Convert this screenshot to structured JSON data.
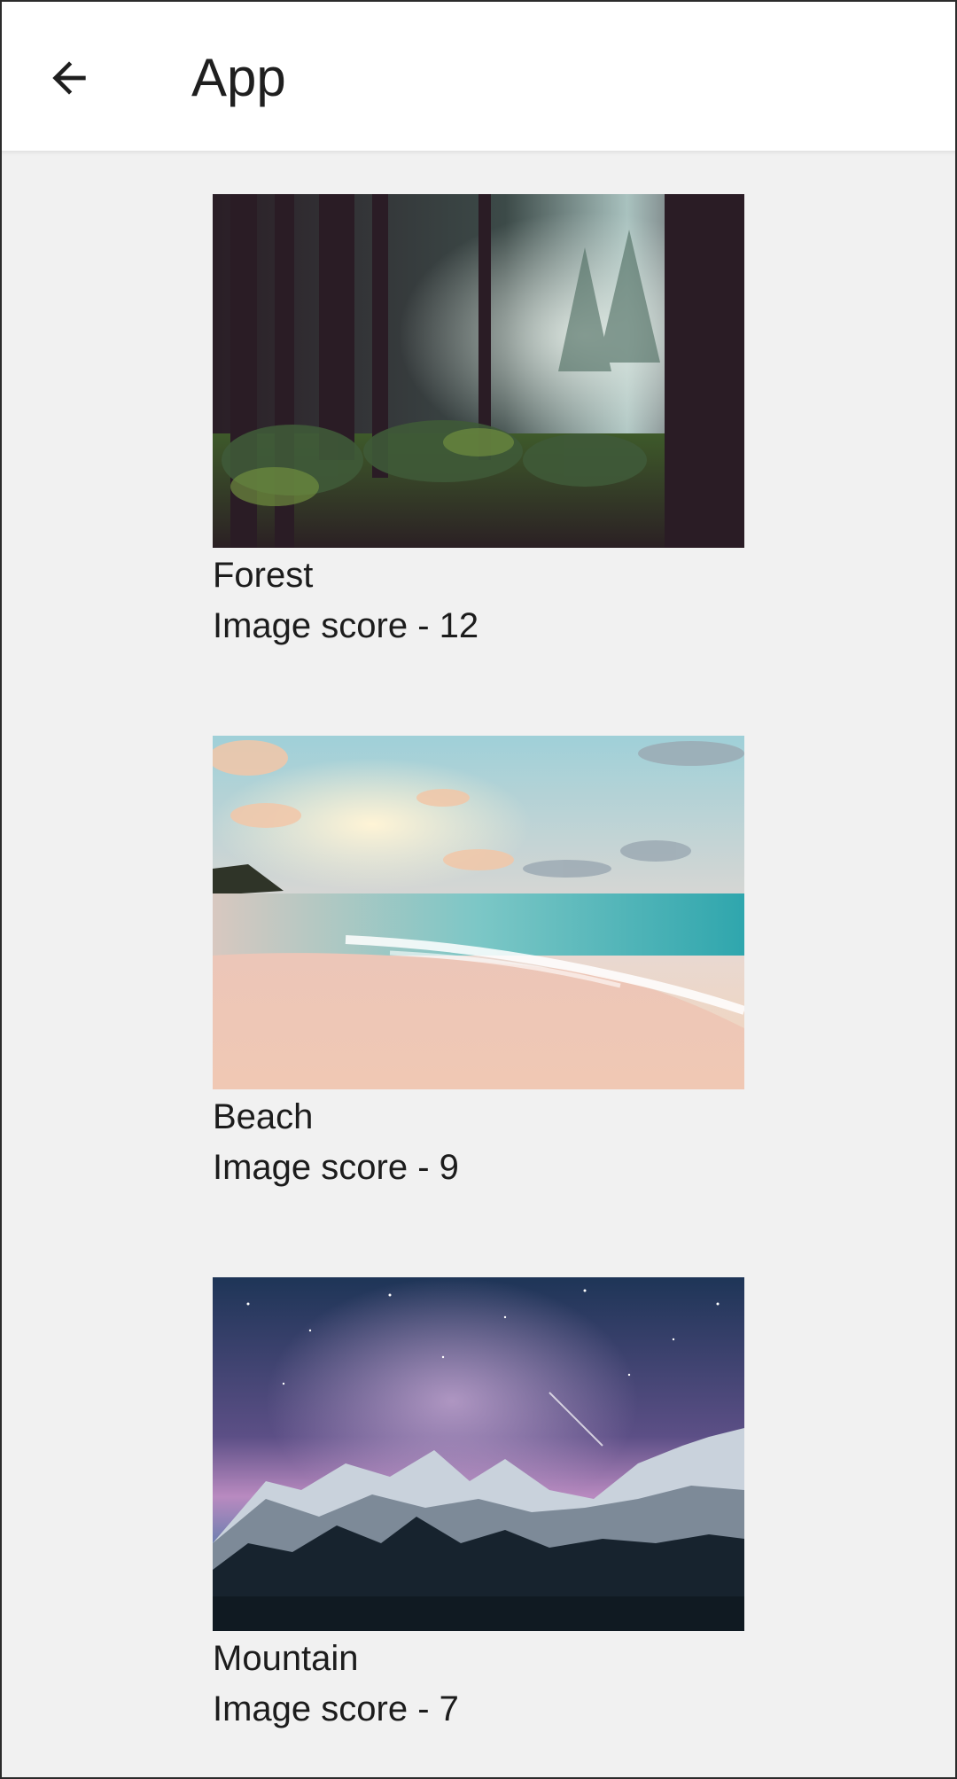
{
  "appbar": {
    "back_icon": "arrow-back-icon",
    "title": "App"
  },
  "items": [
    {
      "name": "Forest",
      "score_text": "Image score - 12"
    },
    {
      "name": "Beach",
      "score_text": "Image score - 9"
    },
    {
      "name": "Mountain",
      "score_text": "Image score - 7"
    }
  ],
  "colors": {
    "background": "#f1f1f1",
    "appbar": "#ffffff",
    "text": "#1f1f1f"
  }
}
